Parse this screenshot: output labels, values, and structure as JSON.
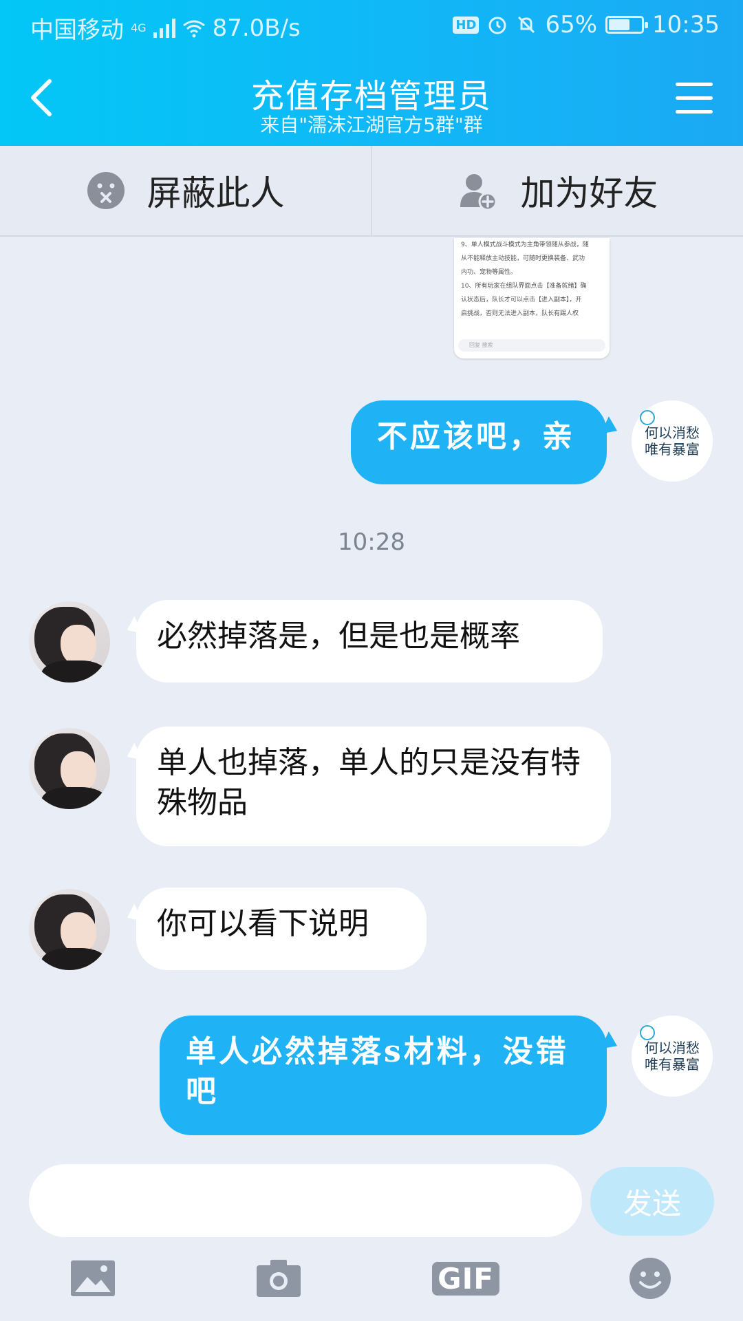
{
  "status_bar": {
    "carrier": "中国移动",
    "network": "4G",
    "speed": "87.0B/s",
    "hd": "HD",
    "battery_percent": "65%",
    "battery_level": 0.65,
    "time": "10:35"
  },
  "header": {
    "title": "充值存档管理员",
    "subtitle": "来自\"濡沫江湖官方5群\"群",
    "back_icon": "chevron-left-icon",
    "menu_icon": "hamburger-icon"
  },
  "actions": {
    "block_label": "屏蔽此人",
    "add_friend_label": "加为好友"
  },
  "preview_image": {
    "lines": [
      "9、单人模式战斗模式为主角带领随从参战，随",
      "从不能释放主动技能，可随时更换装备、武功",
      "内功、宠物等属性。",
      "10、所有玩家在组队界面点击【准备就绪】确",
      "认状态后，队长才可以点击【进入副本】，开",
      "启挑战，否则无法进入副本，队长有踢人权"
    ],
    "search_hint": "回复 搜索"
  },
  "my_avatar": {
    "line1": "何以消愁",
    "line2": "唯有暴富"
  },
  "messages": {
    "m1": "不应该吧，亲",
    "timestamp": "10:28",
    "m2": "必然掉落是，但是也是概率",
    "m3": "单人也掉落，单人的只是没有特殊物品",
    "m4": "你可以看下说明",
    "m5": "单人必然掉落s材料，没错吧"
  },
  "input": {
    "value": "",
    "send_label": "发送"
  },
  "toolbar": {
    "gif_label": "GIF"
  },
  "colors": {
    "header_start": "#03c7f6",
    "header_end": "#1ba9f3",
    "my_bubble": "#1fb3f5",
    "background": "#e9edf5",
    "send_disabled": "#bfe9fb"
  }
}
